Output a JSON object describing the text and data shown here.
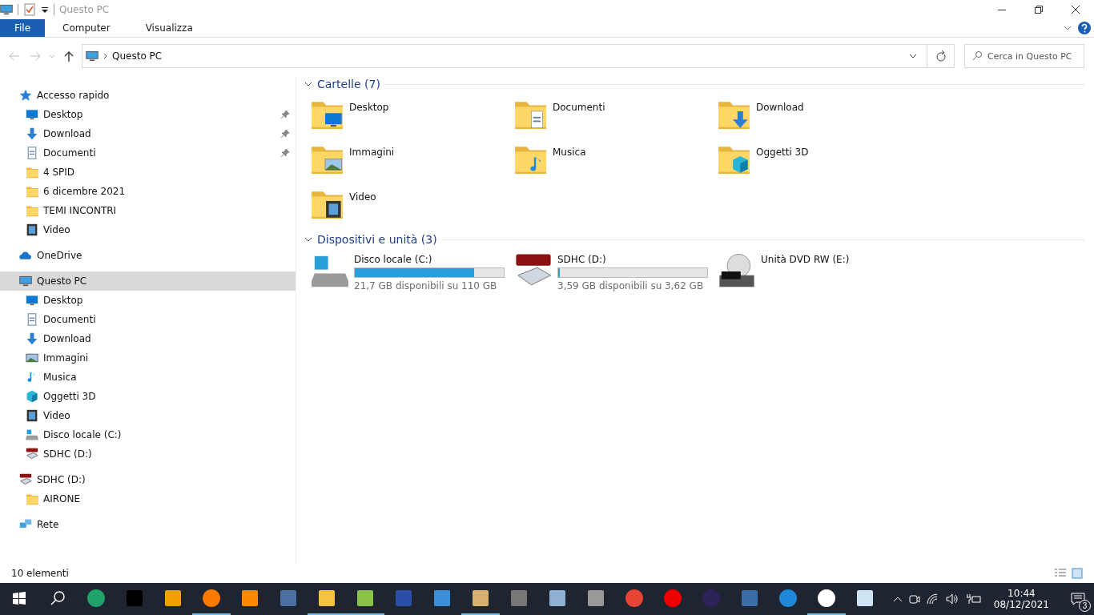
{
  "window": {
    "title": "Questo PC"
  },
  "ribbon": {
    "tabs": [
      {
        "label": "File",
        "selected": true
      },
      {
        "label": "Computer",
        "selected": false
      },
      {
        "label": "Visualizza",
        "selected": false
      }
    ]
  },
  "address": {
    "path": "Questo PC"
  },
  "search": {
    "placeholder": "Cerca in Questo PC"
  },
  "sidebar": {
    "items": [
      {
        "label": "Accesso rapido",
        "kind": "star",
        "selected": false,
        "children": [
          {
            "label": "Desktop",
            "kind": "desktop",
            "pinned": true
          },
          {
            "label": "Download",
            "kind": "download",
            "pinned": true
          },
          {
            "label": "Documenti",
            "kind": "documents",
            "pinned": true
          },
          {
            "label": "4 SPID",
            "kind": "folder",
            "pinned": false
          },
          {
            "label": "6 dicembre 2021",
            "kind": "folder",
            "pinned": false
          },
          {
            "label": "TEMI INCONTRI",
            "kind": "folder",
            "pinned": false
          },
          {
            "label": "Video",
            "kind": "video",
            "pinned": false
          }
        ]
      },
      {
        "label": "OneDrive",
        "kind": "cloud",
        "selected": false
      },
      {
        "label": "Questo PC",
        "kind": "pc",
        "selected": true,
        "children": [
          {
            "label": "Desktop",
            "kind": "desktop",
            "pinned": false
          },
          {
            "label": "Documenti",
            "kind": "documents",
            "pinned": false
          },
          {
            "label": "Download",
            "kind": "download",
            "pinned": false
          },
          {
            "label": "Immagini",
            "kind": "pictures",
            "pinned": false
          },
          {
            "label": "Musica",
            "kind": "music",
            "pinned": false
          },
          {
            "label": "Oggetti 3D",
            "kind": "cube",
            "pinned": false
          },
          {
            "label": "Video",
            "kind": "video",
            "pinned": false
          },
          {
            "label": "Disco locale (C:)",
            "kind": "disk",
            "pinned": false
          },
          {
            "label": "SDHC (D:)",
            "kind": "sd",
            "pinned": false
          }
        ]
      },
      {
        "label": "SDHC (D:)",
        "kind": "sd",
        "selected": false,
        "children": [
          {
            "label": "AIRONE",
            "kind": "folder",
            "pinned": false
          }
        ]
      },
      {
        "label": "Rete",
        "kind": "network",
        "selected": false
      }
    ]
  },
  "folders": {
    "title": "Cartelle (7)",
    "items": [
      {
        "label": "Desktop",
        "kind": "desktop"
      },
      {
        "label": "Documenti",
        "kind": "documents"
      },
      {
        "label": "Download",
        "kind": "download"
      },
      {
        "label": "Immagini",
        "kind": "pictures"
      },
      {
        "label": "Musica",
        "kind": "music"
      },
      {
        "label": "Oggetti 3D",
        "kind": "cube"
      },
      {
        "label": "Video",
        "kind": "video"
      }
    ]
  },
  "devices": {
    "title": "Dispositivi e unità (3)",
    "items": [
      {
        "label": "Disco locale (C:)",
        "kind": "disk",
        "level": 0.8,
        "free": "21,7 GB disponibili su 110 GB"
      },
      {
        "label": "SDHC (D:)",
        "kind": "sd",
        "level": 0.01,
        "free": "3,59 GB disponibili su 3,62 GB"
      },
      {
        "label": "Unità DVD RW (E:)",
        "kind": "dvd"
      }
    ]
  },
  "status_bar": {
    "count": "10 elementi"
  },
  "taskbar": {
    "apps": [
      {
        "kind": "edge",
        "running": false
      },
      {
        "kind": "terminal",
        "running": false
      },
      {
        "kind": "audio",
        "running": false
      },
      {
        "kind": "firefox",
        "running": true
      },
      {
        "kind": "cone",
        "running": false
      },
      {
        "kind": "calculator",
        "running": false
      },
      {
        "kind": "explorer",
        "running": true
      },
      {
        "kind": "notepad",
        "running": true
      },
      {
        "kind": "floppy",
        "running": false
      },
      {
        "kind": "panel",
        "running": false
      },
      {
        "kind": "palette",
        "running": true
      },
      {
        "kind": "gimp",
        "running": false
      },
      {
        "kind": "photos",
        "running": false
      },
      {
        "kind": "microphone",
        "running": false
      },
      {
        "kind": "chrome",
        "running": false
      },
      {
        "kind": "record",
        "running": false
      },
      {
        "kind": "eclipse",
        "running": false
      },
      {
        "kind": "writer",
        "running": false
      },
      {
        "kind": "bird",
        "running": false
      },
      {
        "kind": "gear",
        "running": true
      },
      {
        "kind": "weather",
        "running": false
      }
    ],
    "time": "10:44",
    "date": "08/12/2021",
    "notifications": "3"
  }
}
